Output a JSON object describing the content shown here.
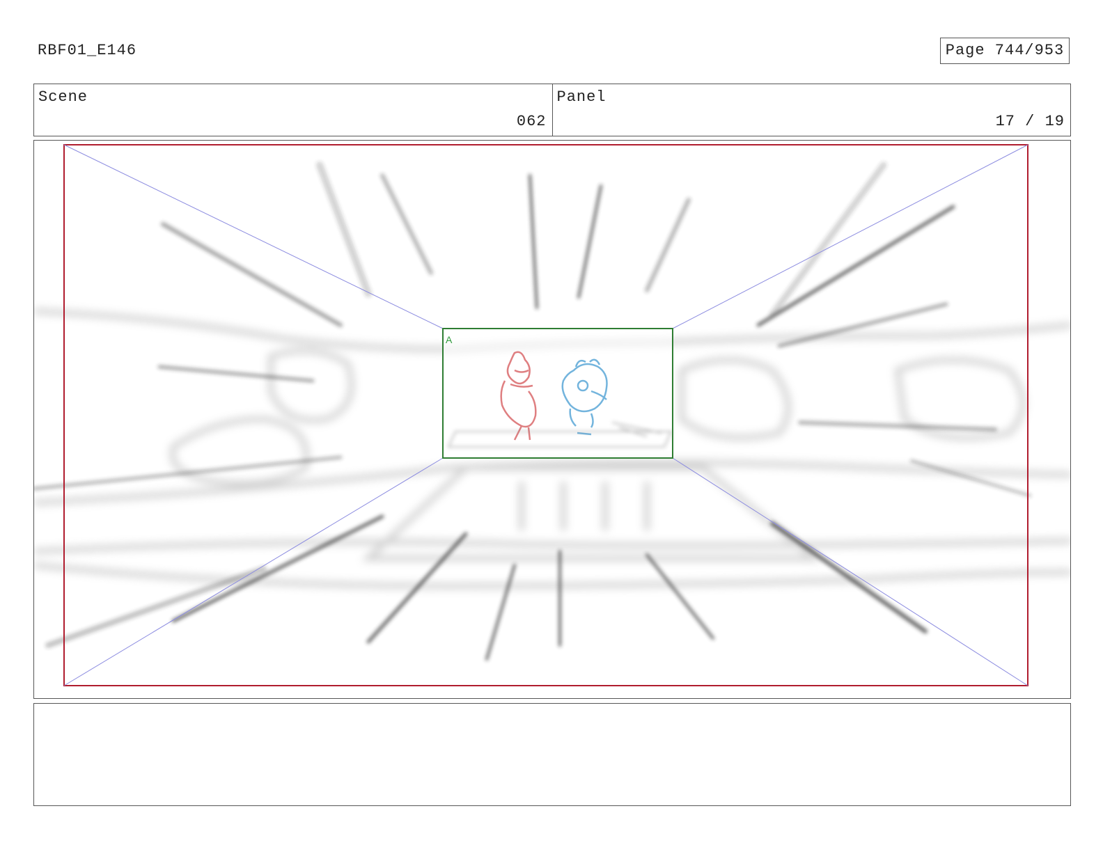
{
  "header": {
    "production_id": "RBF01_E146",
    "page_label": "Page 744/953"
  },
  "info": {
    "scene_label": "Scene",
    "scene_value": "062",
    "panel_label": "Panel",
    "panel_value": "17 / 19"
  },
  "panel": {
    "layer_label": "A",
    "colors": {
      "camera_frame": "#b01c2e",
      "field_guide": "#8c8ce0",
      "inner_frame": "#2e7d32",
      "character_red": "#d9686a",
      "character_blue": "#5aa7d6",
      "speed_lines": "#2a2a2a"
    }
  },
  "notes": {
    "text": ""
  }
}
